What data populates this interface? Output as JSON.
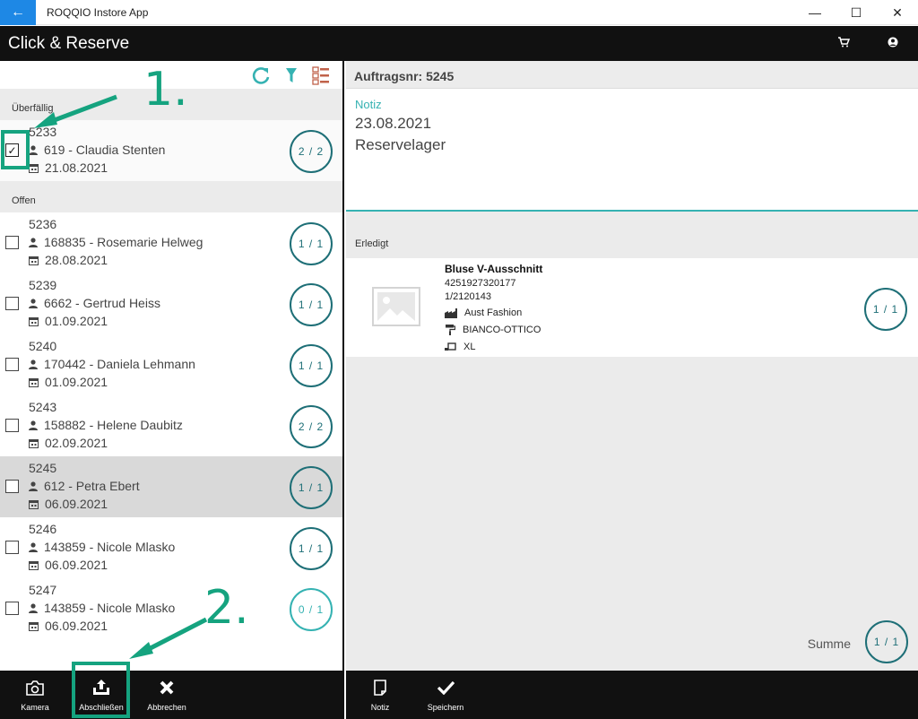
{
  "window": {
    "title": "ROQQIO Instore App",
    "back_glyph": "←",
    "minimize_glyph": "—",
    "maximize_glyph": "☐",
    "close_glyph": "✕"
  },
  "app": {
    "title": "Click & Reserve"
  },
  "left": {
    "groups": [
      {
        "label": "Überfällig"
      },
      {
        "label": "Offen"
      }
    ],
    "overdue_items": [
      {
        "order": "5233",
        "customer": "619 - Claudia Stenten",
        "date": "21.08.2021",
        "count": "2 / 2",
        "checked": true
      }
    ],
    "open_items": [
      {
        "order": "5236",
        "customer": "168835 - Rosemarie Helweg",
        "date": "28.08.2021",
        "count": "1 / 1"
      },
      {
        "order": "5239",
        "customer": "6662 - Gertrud Heiss",
        "date": "01.09.2021",
        "count": "1 / 1"
      },
      {
        "order": "5240",
        "customer": "170442 - Daniela Lehmann",
        "date": "01.09.2021",
        "count": "1 / 1"
      },
      {
        "order": "5243",
        "customer": "158882 - Helene Daubitz",
        "date": "02.09.2021",
        "count": "2 / 2"
      },
      {
        "order": "5245",
        "customer": "612 - Petra Ebert",
        "date": "06.09.2021",
        "count": "1 / 1",
        "selected": true
      },
      {
        "order": "5246",
        "customer": "143859 - Nicole Mlasko",
        "date": "06.09.2021",
        "count": "1 / 1"
      },
      {
        "order": "5247",
        "customer": "143859 - Nicole Mlasko",
        "date": "06.09.2021",
        "count": "0 / 1"
      }
    ]
  },
  "right": {
    "order_header": "Auftragsnr: 5245",
    "note_label": "Notiz",
    "note_lines": [
      "23.08.2021",
      "Reservelager"
    ],
    "done_header": "Erledigt",
    "product": {
      "name": "Bluse V-Ausschnitt",
      "ean": "4251927320177",
      "article": "1/2120143",
      "supplier": "Aust Fashion",
      "color": "BIANCO-OTTICO",
      "size": "XL",
      "count": "1 / 1"
    },
    "sum_label": "Summe",
    "sum_count": "1 / 1"
  },
  "bottom": {
    "camera": "Kamera",
    "finish": "Abschließen",
    "cancel": "Abbrechen",
    "note": "Notiz",
    "save": "Speichern"
  },
  "annotations": {
    "step1": "1.",
    "step2": "2."
  },
  "colors": {
    "accent": "#35b2b2",
    "badge": "#1e6f77",
    "annotation": "#15a37f",
    "bar": "#111111"
  }
}
